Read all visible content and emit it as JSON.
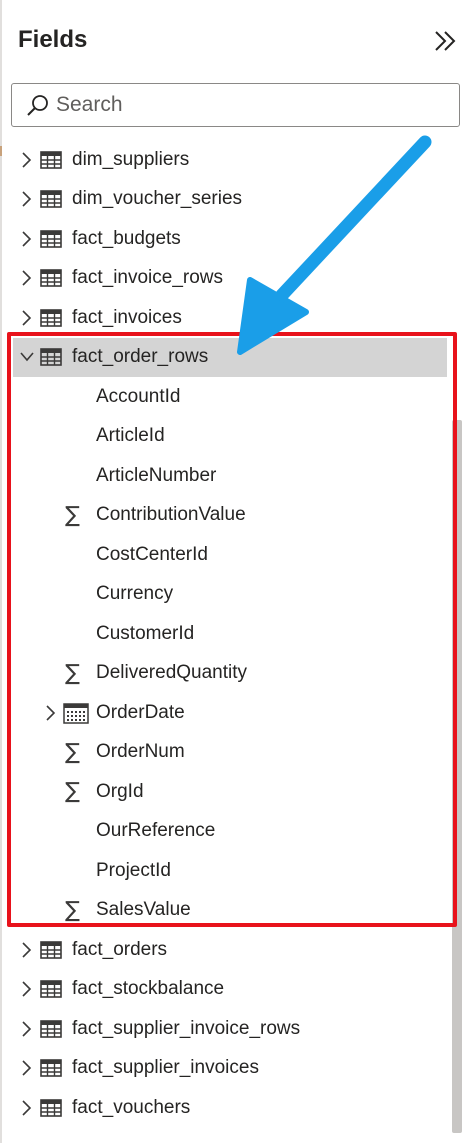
{
  "pane": {
    "title": "Fields",
    "collapse_icon": "double-chevron-right-icon"
  },
  "search": {
    "placeholder": "Search",
    "value": "",
    "icon": "search-icon"
  },
  "tables_before": [
    {
      "name": "dim_suppliers",
      "expanded": false
    },
    {
      "name": "dim_voucher_series",
      "expanded": false
    },
    {
      "name": "fact_budgets",
      "expanded": false
    },
    {
      "name": "fact_invoice_rows",
      "expanded": false
    },
    {
      "name": "fact_invoices",
      "expanded": false
    }
  ],
  "expanded_table": {
    "name": "fact_order_rows",
    "expanded": true,
    "fields": [
      {
        "name": "AccountId",
        "type": "text"
      },
      {
        "name": "ArticleId",
        "type": "text"
      },
      {
        "name": "ArticleNumber",
        "type": "text"
      },
      {
        "name": "ContributionValue",
        "type": "sum"
      },
      {
        "name": "CostCenterId",
        "type": "text"
      },
      {
        "name": "Currency",
        "type": "text"
      },
      {
        "name": "CustomerId",
        "type": "text"
      },
      {
        "name": "DeliveredQuantity",
        "type": "sum"
      },
      {
        "name": "OrderDate",
        "type": "date-hierarchy"
      },
      {
        "name": "OrderNum",
        "type": "sum"
      },
      {
        "name": "OrgId",
        "type": "sum"
      },
      {
        "name": "OurReference",
        "type": "text"
      },
      {
        "name": "ProjectId",
        "type": "text"
      },
      {
        "name": "SalesValue",
        "type": "sum"
      }
    ]
  },
  "tables_after": [
    {
      "name": "fact_orders",
      "expanded": false
    },
    {
      "name": "fact_stockbalance",
      "expanded": false
    },
    {
      "name": "fact_supplier_invoice_rows",
      "expanded": false
    },
    {
      "name": "fact_supplier_invoices",
      "expanded": false
    },
    {
      "name": "fact_vouchers",
      "expanded": false
    }
  ],
  "annotation": {
    "highlight_color": "#e8121b",
    "arrow_color": "#1a9ee8"
  },
  "colors": {
    "text": "#252423",
    "selected_row": "#d4d4d4",
    "icon": "#3b3a39"
  }
}
